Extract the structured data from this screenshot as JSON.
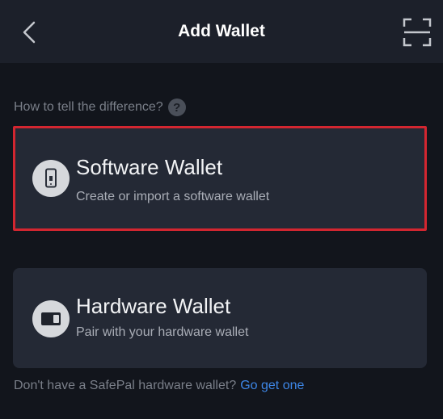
{
  "header": {
    "title": "Add Wallet",
    "back_icon": "chevron-left-icon",
    "scan_icon": "scan-icon"
  },
  "help": {
    "text": "How to tell the difference?",
    "icon_glyph": "?"
  },
  "options": {
    "software": {
      "title": "Software Wallet",
      "subtitle": "Create or import a software wallet",
      "icon": "phone-icon"
    },
    "hardware": {
      "title": "Hardware Wallet",
      "subtitle": "Pair with your hardware wallet",
      "icon": "hardware-device-icon"
    }
  },
  "footer": {
    "text": "Don't have a SafePal hardware wallet?",
    "link": "Go get one"
  },
  "colors": {
    "background": "#12151c",
    "header": "#1c202a",
    "card": "#242935",
    "highlight_border": "#d32630",
    "link": "#3d86e6"
  }
}
